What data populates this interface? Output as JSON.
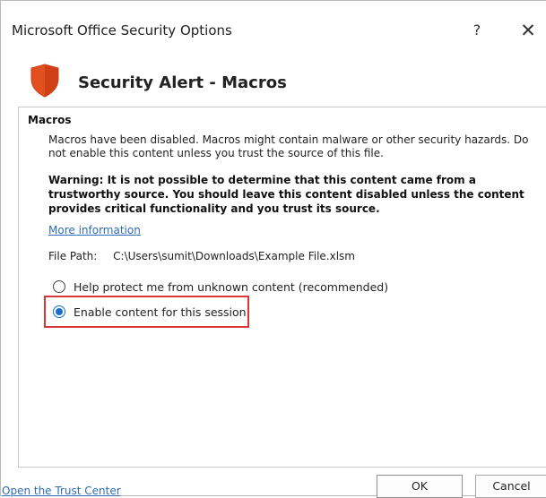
{
  "window": {
    "title": "Microsoft Office Security Options",
    "help_glyph": "?",
    "close_glyph": "✕"
  },
  "alert": {
    "title": "Security Alert - Macros",
    "icon": "shield-icon",
    "icon_color": "#e2501f"
  },
  "macros": {
    "heading": "Macros",
    "description": "Macros have been disabled. Macros might contain malware or other security hazards. Do not enable this content unless you trust the source of this file.",
    "warning": "Warning: It is not possible to determine that this content came from a trustworthy source. You should leave this content disabled unless the content provides critical functionality and you trust its source.",
    "more_info_link": "More information",
    "file_path_label": "File Path:",
    "file_path_value": "C:\\Users\\sumit\\Downloads\\Example File.xlsm"
  },
  "options": [
    {
      "label": "Help protect me from unknown content (recommended)",
      "selected": false
    },
    {
      "label": "Enable content for this session",
      "selected": true
    }
  ],
  "footer": {
    "trust_center_link": "Open the Trust Center",
    "ok_label": "OK",
    "cancel_label": "Cancel"
  },
  "colors": {
    "link": "#2f6cb3",
    "radio_selected": "#1a6fc9",
    "highlight_box": "#d93636"
  }
}
